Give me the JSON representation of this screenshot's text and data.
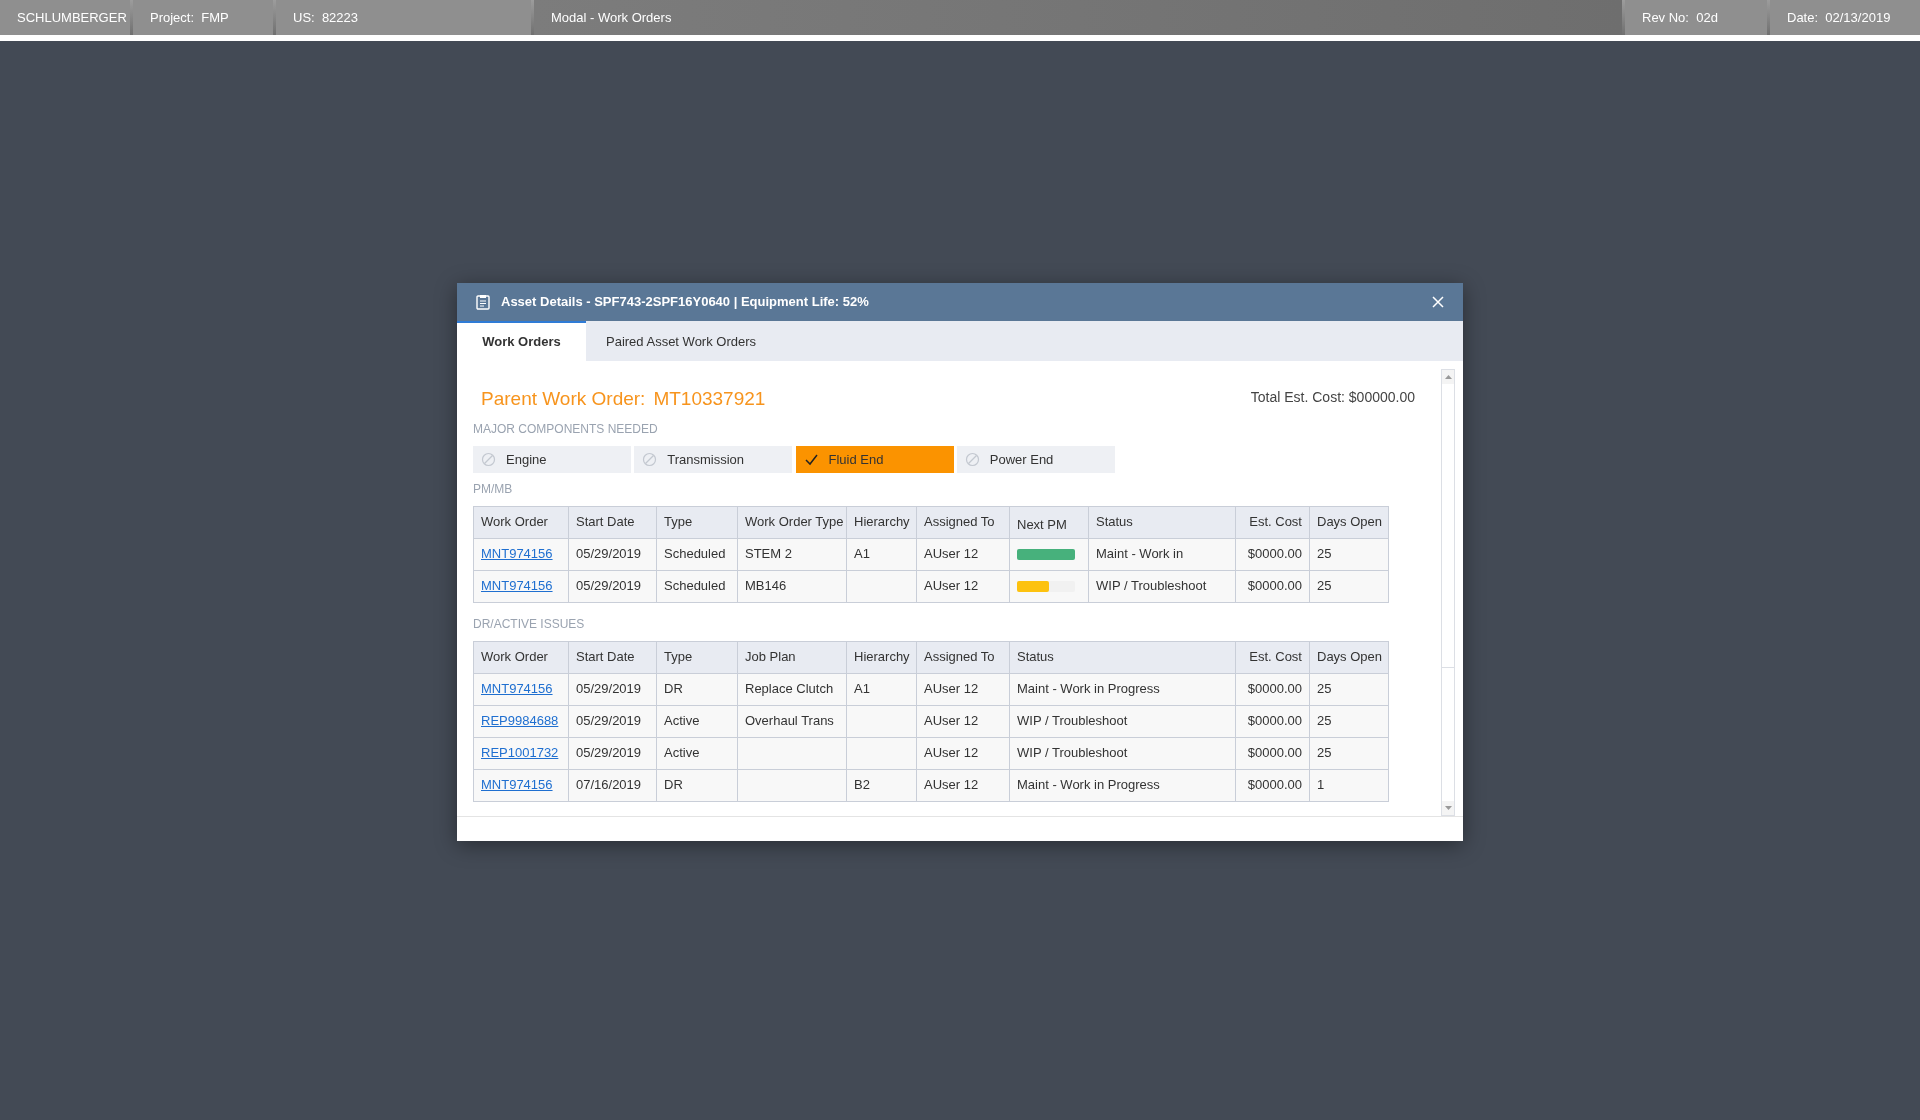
{
  "top_bar": [
    {
      "label": "SCHLUMBERGER"
    },
    {
      "label": "Project:",
      "value": "FMP"
    },
    {
      "label": "US:",
      "value": "82223"
    },
    {
      "label": "Modal - Work Orders"
    },
    {
      "label": "Rev No:",
      "value": "02d"
    },
    {
      "label": "Date:",
      "value": "02/13/2019"
    }
  ],
  "modal": {
    "title": "Asset Details - SPF743-2SPF16Y0640 | Equipment Life: 52%",
    "tabs": [
      {
        "label": "Work Orders",
        "selected": true
      },
      {
        "label": "Paired Asset Work Orders",
        "selected": false
      }
    ],
    "parent_label": "Parent Work Order:",
    "parent_value": "MT10337921",
    "total_cost": "Total Est. Cost: $00000.00",
    "components_heading": "MAJOR COMPONENTS NEEDED",
    "components": [
      {
        "label": "Engine",
        "checked": false
      },
      {
        "label": "Transmission",
        "checked": false
      },
      {
        "label": "Fluid End",
        "checked": true
      },
      {
        "label": "Power End",
        "checked": false
      }
    ],
    "sections": [
      {
        "heading": "PM/MB",
        "columns": [
          "Work Order",
          "Start Date",
          "Type",
          "Work Order Type",
          "Hierarchy",
          "Assigned To",
          "Next PM",
          "Status",
          "Est. Cost",
          "Days Open"
        ],
        "rows": [
          [
            "MNT974156",
            "05/29/2019",
            "Scheduled",
            "STEM 2",
            "A1",
            "AUser 12",
            {
              "kind": "bar",
              "level": 1,
              "color": "#47b17c"
            },
            "Maint - Work in",
            "$0000.00",
            "25"
          ],
          [
            "MNT974156",
            "05/29/2019",
            "Scheduled",
            "MB146",
            "",
            "AUser 12",
            {
              "kind": "bar",
              "level": 0.55,
              "color": "#fdc20f"
            },
            "WIP / Troubleshoot",
            "$0000.00",
            "25"
          ]
        ]
      },
      {
        "heading": "DR/ACTIVE ISSUES",
        "columns": [
          "Work Order",
          "Start Date",
          "Type",
          "Job Plan",
          "Hierarchy",
          "Assigned To",
          "Status",
          "Est. Cost",
          "Days Open"
        ],
        "rows": [
          [
            "MNT974156",
            "05/29/2019",
            "DR",
            "Replace Clutch",
            "A1",
            "AUser 12",
            "Maint - Work in Progress",
            "$0000.00",
            "25"
          ],
          [
            "REP9984688",
            "05/29/2019",
            "Active",
            "Overhaul Trans",
            "",
            "AUser 12",
            "WIP / Troubleshoot",
            "$0000.00",
            "25"
          ],
          [
            "REP1001732",
            "05/29/2019",
            "Active",
            "",
            "",
            "AUser 12",
            "WIP / Troubleshoot",
            "$0000.00",
            "25"
          ],
          [
            "MNT974156",
            "07/16/2019",
            "DR",
            "",
            "B2",
            "AUser 12",
            "Maint - Work in Progress",
            "$0000.00",
            "1"
          ]
        ]
      }
    ]
  }
}
